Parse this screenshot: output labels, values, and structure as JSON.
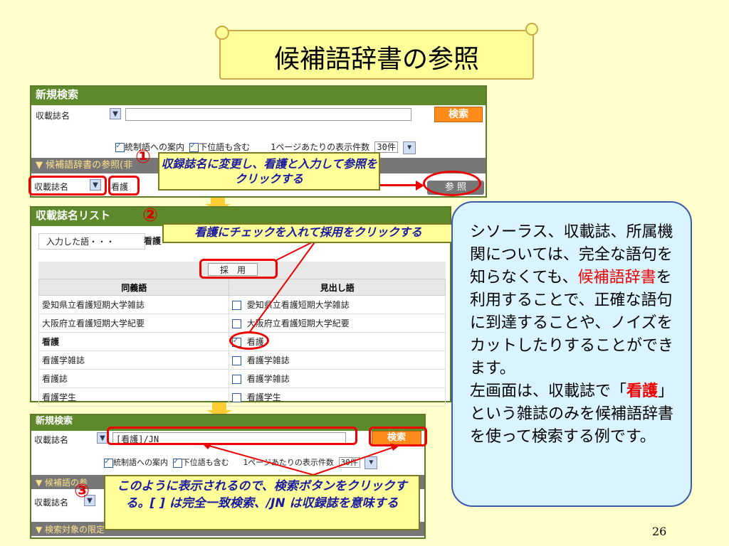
{
  "title": "候補語辞書の参照",
  "panel1": {
    "header": "新規検索",
    "field_select": "収載誌名",
    "search_button": "検索",
    "check_guide": "統制語への案内",
    "check_lower": "下位語も含む",
    "per_page_label": "1ページあたりの表示件数",
    "per_page_value": "30件",
    "subbar": "▼ 候補語辞書の参照",
    "subbar_tail": "(非",
    "field_select2": "収載誌名",
    "term_input": "看護",
    "ref_button": "参 照"
  },
  "callout1": {
    "num": "①",
    "text": "収録誌名に変更し、看護と入力して参照をクリックする"
  },
  "panel2": {
    "header": "収載誌名リスト",
    "input_label": "入力した語・・・",
    "input_value": "看護",
    "adopt_button": "採　用",
    "col_synonym": "同義語",
    "col_heading": "見出し語",
    "rows": [
      {
        "synonym": "愛知県立看護短期大学雑誌",
        "heading": "愛知県立看護短期大学雑誌",
        "checked": false
      },
      {
        "synonym": "大阪府立看護短期大学紀要",
        "heading": "大阪府立看護短期大学紀要",
        "checked": false
      },
      {
        "synonym": "看護",
        "heading": "看護",
        "checked": true
      },
      {
        "synonym": "看護学雑誌",
        "heading": "看護学雑誌",
        "checked": false
      },
      {
        "synonym": "看護誌",
        "heading": "看護学雑誌",
        "checked": false
      },
      {
        "synonym": "看護学生",
        "heading": "看護学生",
        "checked": false
      }
    ]
  },
  "callout2": {
    "num": "②",
    "text": "看護にチェックを入れて採用をクリックする"
  },
  "panel3": {
    "header": "新規検索",
    "field_select": "収載誌名",
    "query": "[看護]/JN",
    "search_button": "検索",
    "check_guide": "統制語への案内",
    "check_lower": "下位語も含む",
    "per_page_label": "1ページあたりの表示件数",
    "per_page_value": "30件",
    "subbar": "▼ 候補語",
    "subbar_tail": "の参",
    "field_select2": "収載誌名",
    "bottom_bar": "▼ 検索対象の限定"
  },
  "callout3": {
    "num": "③",
    "text": "このように表示されるので、検索ボタンをクリックする。[ ] は完全一致検索、/JN は収録誌を意味する"
  },
  "info": {
    "line1": "シソーラス、収載誌、所属機関については、完全な語句を知らなくても、",
    "highlight1": "候補語辞書",
    "line2": "を利用することで、正確な語句に到達することや、ノイズをカットしたりすることができます。",
    "line3a": "左画面は、収載誌で「",
    "highlight2": "看護",
    "line3b": "」という雑誌のみを候補語辞書を使って検索する例です。"
  },
  "page_number": "26"
}
